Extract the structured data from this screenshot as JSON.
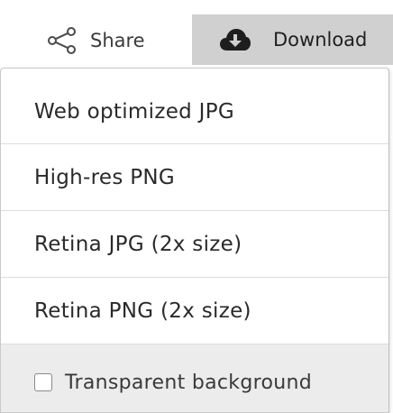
{
  "toolbar": {
    "share_label": "Share",
    "share_icon": "share-icon",
    "download_label": "Download",
    "download_icon": "cloud-download-icon"
  },
  "menu": {
    "items": [
      {
        "label": "Web optimized JPG"
      },
      {
        "label": "High-res PNG"
      },
      {
        "label": "Retina JPG (2x size)"
      },
      {
        "label": "Retina PNG (2x size)"
      }
    ],
    "transparent_label": "Transparent background",
    "transparent_checked": false
  },
  "colors": {
    "download_bg": "#d0d0d0",
    "footer_bg": "#ececec"
  }
}
